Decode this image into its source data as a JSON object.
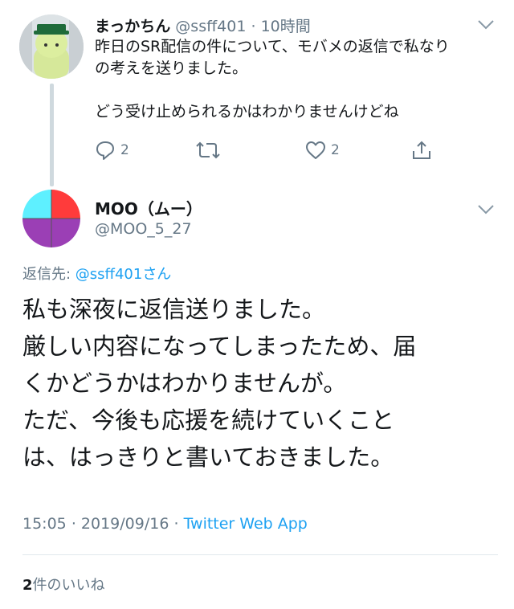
{
  "parent_tweet": {
    "display_name": "まっかちん",
    "handle": "@ssff401",
    "separator": "·",
    "time_ago": "10時間",
    "text_line1": "昨日のSR配信の件について、モバメの返信で私なり",
    "text_line2": "の考えを送りました。",
    "text_line3": "どう受け止められるかはわかりませんけどね",
    "reply_count": "2",
    "like_count": "2",
    "icons": [
      "reply-icon",
      "retweet-icon",
      "like-icon",
      "share-icon",
      "chevron-down-icon"
    ]
  },
  "main_tweet": {
    "display_name": "MOO（ムー）",
    "handle": "@MOO_5_27",
    "reply_prefix": "返信先: ",
    "reply_handle": "@ssff401",
    "reply_suffix": "さん",
    "lines": [
      "私も深夜に返信送りました。",
      "厳しい内容になってしまったため、届",
      "くかどうかはわかりませんが。",
      "ただ、今後も応援を続けていくこと",
      "は、はっきりと書いておきました。"
    ],
    "time": "15:05",
    "date": "2019/09/16",
    "separator": "·",
    "source": "Twitter Web App",
    "like_count": "2",
    "like_label": "件のいいね",
    "avatar_colors": [
      "#ff3b3b",
      "#5ef0ff",
      "#9b3fb5"
    ]
  },
  "colors": {
    "text": "#14171a",
    "secondary": "#657786",
    "link": "#1da1f2",
    "divider": "#e1e8ed"
  }
}
